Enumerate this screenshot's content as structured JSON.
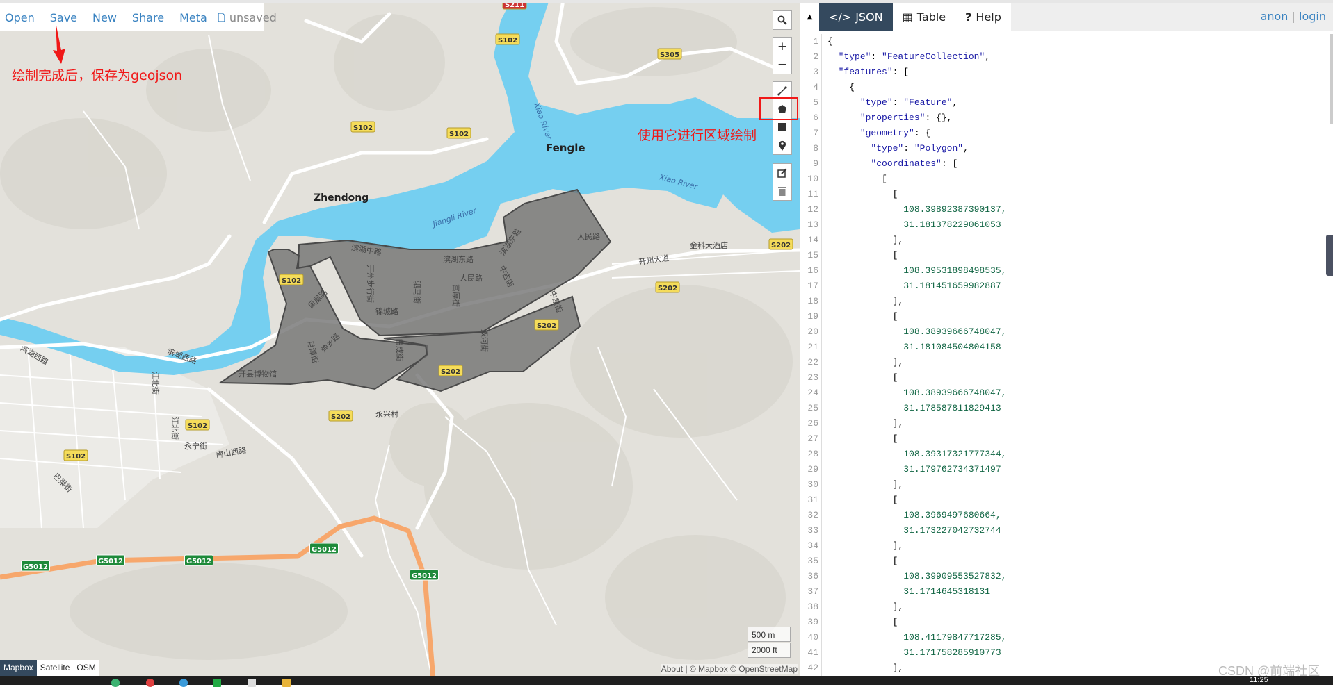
{
  "toolbar": {
    "items": [
      "Open",
      "Save",
      "New",
      "Share",
      "Meta"
    ],
    "file_icon": "file-icon",
    "status": "unsaved"
  },
  "annotations": {
    "save_hint": "绘制完成后，保存为geojson",
    "polygon_hint": "使用它进行区域绘制",
    "color": "#f01818"
  },
  "map_controls": {
    "search": "search-icon",
    "zoom_in": "+",
    "zoom_out": "−",
    "draw_tools": [
      "line-icon",
      "polygon-icon",
      "rectangle-icon",
      "marker-icon"
    ],
    "edit_tools": [
      "edit-icon",
      "trash-icon"
    ]
  },
  "map": {
    "places": {
      "fengle": "Fengle",
      "zhendong": "Zhendong",
      "jiangli": "Jiangli River",
      "xiao1": "Xiao River",
      "xiao2": "Xiao River",
      "hotel": "金科大酒店",
      "kaizhou": "开州大道",
      "yongxing": "永兴村",
      "nanshan": "南山西路",
      "binhuxi": "滨湖西路",
      "jiangbei": "江北街",
      "binhuzhong": "滨湖中路",
      "binhudong": "滨湖东路",
      "renmin": "人民路",
      "renmin2": "人民路",
      "buxing": "开州步行街",
      "jincheng": "锦城路",
      "sima": "驷马街",
      "fuhou": "富厚街",
      "zhongji": "中吉街",
      "fenghuang": "凤凰路",
      "yuetan": "月潭街",
      "shuaixiang": "帅乡路",
      "baicheng": "白成街",
      "shuanghe": "双河街",
      "museum": "开县博物馆",
      "zhongyuan": "中原街",
      "jiangbei2": "江北街",
      "yongning": "永宁街",
      "bashu": "巴渠街"
    },
    "shields": {
      "s102": "S102",
      "s202": "S202",
      "s305": "S305",
      "s211": "S211",
      "g5012": "G5012"
    },
    "colors": {
      "water": "#75cff0",
      "polygon": "#6e6e6e",
      "highway": "#f7a76c",
      "land": "#e3e1db"
    },
    "layers": [
      "Mapbox",
      "Satellite",
      "OSM"
    ],
    "active_layer": "Mapbox",
    "scale": {
      "metric": "500 m",
      "imperial": "2000 ft"
    },
    "attribution": "About | © Mapbox © OpenStreetMap"
  },
  "panel": {
    "tabs": [
      {
        "label": "JSON",
        "icon": "code-icon"
      },
      {
        "label": "Table",
        "icon": "table-icon"
      },
      {
        "label": "Help",
        "icon": "help-icon"
      }
    ],
    "active_tab": "JSON",
    "user": {
      "anon": "anon",
      "sep": "|",
      "login": "login"
    },
    "code_lines": [
      "{",
      "  \"type\": \"FeatureCollection\",",
      "  \"features\": [",
      "    {",
      "      \"type\": \"Feature\",",
      "      \"properties\": {},",
      "      \"geometry\": {",
      "        \"type\": \"Polygon\",",
      "        \"coordinates\": [",
      "          [",
      "            [",
      "              108.39892387390137,",
      "              31.181378229061053",
      "            ],",
      "            [",
      "              108.39531898498535,",
      "              31.181451659982887",
      "            ],",
      "            [",
      "              108.38939666748047,",
      "              31.181084504804158",
      "            ],",
      "            [",
      "              108.38939666748047,",
      "              31.178587811829413",
      "            ],",
      "            [",
      "              108.39317321777344,",
      "              31.179762734371497",
      "            ],",
      "            [",
      "              108.3969497680664,",
      "              31.173227042732744",
      "            ],",
      "            [",
      "              108.39909553527832,",
      "              31.1714645318131",
      "            ],",
      "            [",
      "              108.41179847717285,",
      "              31.171758285910773",
      "            ],"
    ]
  },
  "taskbar": {
    "clock": "11:25"
  },
  "watermark": "CSDN @前端社区"
}
